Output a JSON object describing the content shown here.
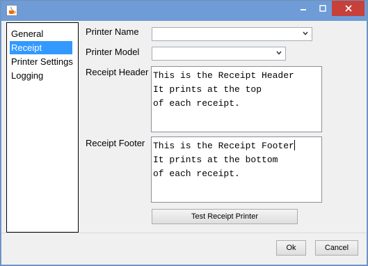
{
  "window": {
    "title": ""
  },
  "sidebar": {
    "items": [
      {
        "label": "General"
      },
      {
        "label": "Receipt"
      },
      {
        "label": "Printer Settings"
      },
      {
        "label": "Logging"
      }
    ],
    "selected_index": 1
  },
  "form": {
    "printer_name_label": "Printer Name",
    "printer_name_value": "",
    "printer_model_label": "Printer Model",
    "printer_model_value": "",
    "receipt_header_label": "Receipt Header",
    "receipt_header_value": "This is the Receipt Header\nIt prints at the top\nof each receipt.",
    "receipt_footer_label": "Receipt Footer",
    "receipt_footer_value": "This is the Receipt Footer\nIt prints at the bottom\nof each receipt.",
    "test_button_label": "Test Receipt Printer"
  },
  "footer": {
    "ok_label": "Ok",
    "cancel_label": "Cancel"
  },
  "icons": {
    "app": "java-cup-icon",
    "minimize": "minimize-icon",
    "maximize": "maximize-icon",
    "close": "close-icon",
    "dropdown": "chevron-down-icon"
  },
  "colors": {
    "titlebar": "#6f9bd6",
    "selection": "#3399ff",
    "close_button": "#c7403a",
    "dialog_background": "#f0f0f0"
  }
}
